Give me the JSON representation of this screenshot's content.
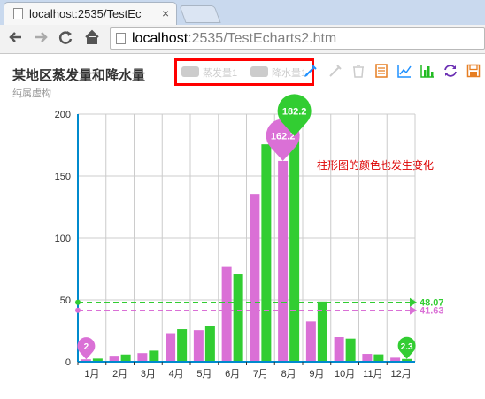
{
  "browser": {
    "tab_title": "localhost:2535/TestEc",
    "tab_close": "×",
    "url_host": "localhost",
    "url_rest": ":2535/TestEcharts2.htm",
    "back_icon": "arrow-left-icon",
    "forward_icon": "arrow-right-icon",
    "reload_icon": "reload-icon",
    "home_icon": "home-icon"
  },
  "chart": {
    "title": "某地区蒸发量和降水量",
    "subtitle": "纯属虚构",
    "legend": [
      "蒸发量1",
      "降水量1"
    ],
    "annotation": "柱形图的颜色也发生变化",
    "toolbox": [
      "mark-icon",
      "mark-undo-icon",
      "mark-clear-icon",
      "data-view-icon",
      "line-chart-icon",
      "bar-chart-icon",
      "restore-icon",
      "save-image-icon"
    ],
    "colors": {
      "evaporation": "#da70d6",
      "precipitation": "#32cd32",
      "legend_disabled": "#cccccc",
      "highlight_box": "#ff0000",
      "annotation": "#dd0000"
    }
  },
  "chart_data": {
    "type": "bar",
    "categories": [
      "1月",
      "2月",
      "3月",
      "4月",
      "5月",
      "6月",
      "7月",
      "8月",
      "9月",
      "10月",
      "11月",
      "12月"
    ],
    "series": [
      {
        "name": "蒸发量1",
        "values": [
          2.0,
          4.9,
          7.0,
          23.2,
          25.6,
          76.7,
          135.6,
          162.2,
          32.6,
          20.0,
          6.4,
          3.3
        ],
        "mark_point_max": {
          "category": "8月",
          "value": "162.2"
        },
        "mark_point_min": {
          "category": "1月",
          "value": "2"
        },
        "mark_line_average": "41.63"
      },
      {
        "name": "降水量1",
        "values": [
          2.6,
          5.9,
          9.0,
          26.4,
          28.7,
          70.7,
          175.6,
          182.2,
          48.7,
          18.8,
          6.0,
          2.3
        ],
        "mark_point_max": {
          "category": "8月",
          "value": "182.2"
        },
        "mark_point_min": {
          "category": "12月",
          "value": "2.3"
        },
        "mark_line_average": "48.07"
      }
    ],
    "yticks": [
      "0",
      "50",
      "100",
      "150",
      "200"
    ],
    "ylim": [
      0,
      200
    ],
    "grid": true
  }
}
